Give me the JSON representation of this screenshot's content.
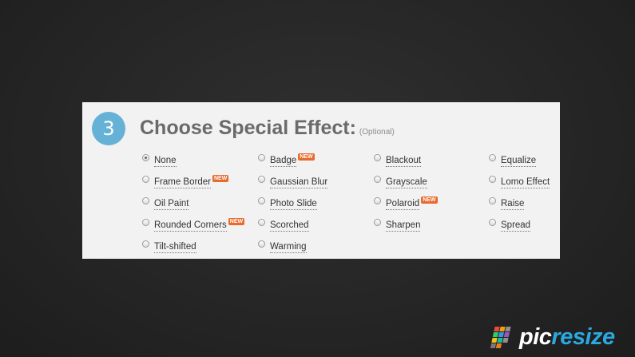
{
  "step": {
    "number": "3"
  },
  "heading": {
    "title": "Choose Special Effect:",
    "optional": "(Optional)"
  },
  "new_badge": "NEW",
  "options": [
    {
      "label": "None",
      "checked": true,
      "new": false
    },
    {
      "label": "Badge",
      "checked": false,
      "new": true
    },
    {
      "label": "Blackout",
      "checked": false,
      "new": false
    },
    {
      "label": "Equalize",
      "checked": false,
      "new": false
    },
    {
      "label": "Frame Border",
      "checked": false,
      "new": true
    },
    {
      "label": "Gaussian Blur",
      "checked": false,
      "new": false
    },
    {
      "label": "Grayscale",
      "checked": false,
      "new": false
    },
    {
      "label": "Lomo Effect",
      "checked": false,
      "new": false
    },
    {
      "label": "Oil Paint",
      "checked": false,
      "new": false
    },
    {
      "label": "Photo Slide",
      "checked": false,
      "new": false
    },
    {
      "label": "Polaroid",
      "checked": false,
      "new": true
    },
    {
      "label": "Raise",
      "checked": false,
      "new": false
    },
    {
      "label": "Rounded Corners",
      "checked": false,
      "new": true
    },
    {
      "label": "Scorched",
      "checked": false,
      "new": false
    },
    {
      "label": "Sharpen",
      "checked": false,
      "new": false
    },
    {
      "label": "Spread",
      "checked": false,
      "new": false
    },
    {
      "label": "Tilt-shifted",
      "checked": false,
      "new": false
    },
    {
      "label": "Warming",
      "checked": false,
      "new": false
    }
  ],
  "logo": {
    "part1": "pic",
    "part2": "resize"
  },
  "colors": {
    "accent": "#66b2d6",
    "new_badge": "#e86a2c",
    "logo_blue": "#2aa9e0"
  }
}
